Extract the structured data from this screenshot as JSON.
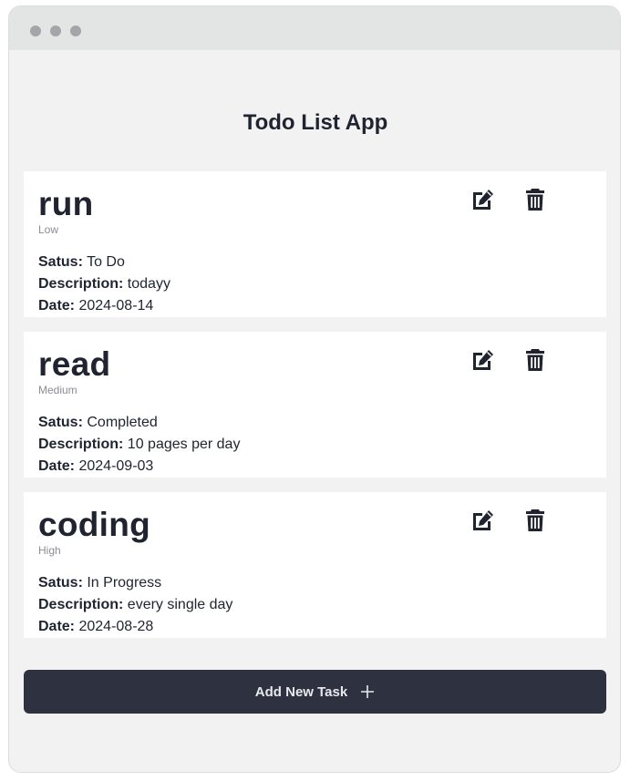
{
  "app": {
    "title": "Todo List App"
  },
  "labels": {
    "status": "Satus:",
    "description": "Description:",
    "date": "Date:"
  },
  "tasks": [
    {
      "title": "run",
      "priority": "Low",
      "status": "To Do",
      "description": "todayy",
      "date": "2024-08-14"
    },
    {
      "title": "read",
      "priority": "Medium",
      "status": "Completed",
      "description": "10 pages per day",
      "date": "2024-09-03"
    },
    {
      "title": "coding",
      "priority": "High",
      "status": "In Progress",
      "description": "every single day",
      "date": "2024-08-28"
    }
  ],
  "actions": {
    "add_task_label": "Add New Task",
    "edit_icon": "edit-icon",
    "delete_icon": "trash-icon",
    "add_icon": "plus-icon"
  },
  "colors": {
    "text": "#1f2430",
    "button_bg": "#2d3140",
    "page_bg": "#f2f2f2"
  }
}
